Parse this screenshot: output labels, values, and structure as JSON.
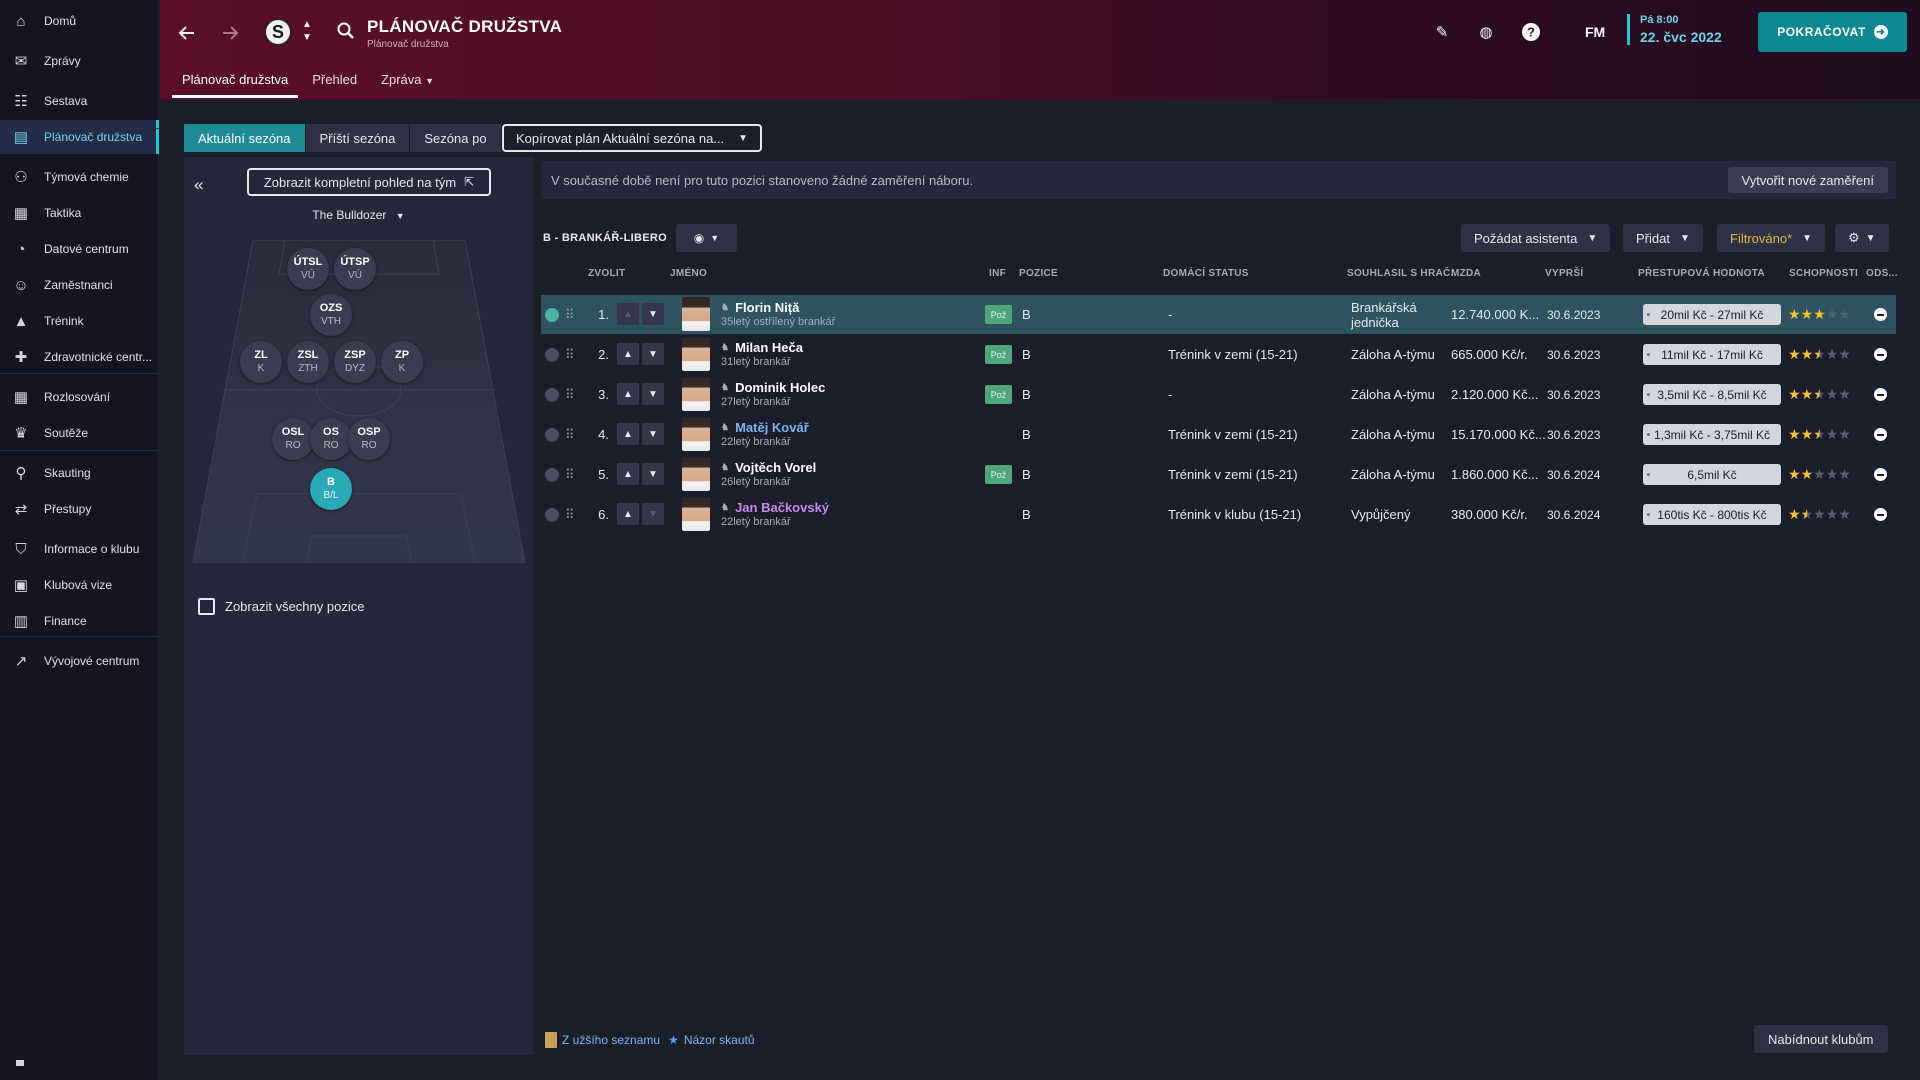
{
  "sidebar": {
    "items": [
      {
        "label": "Domů",
        "icon": "home-icon",
        "glyph": "⌂"
      },
      {
        "label": "Zprávy",
        "icon": "mail-icon",
        "glyph": "✉"
      },
      {
        "label": "Sestava",
        "icon": "squad-icon",
        "glyph": "☷"
      },
      {
        "label": "Plánovač družstva",
        "icon": "planner-icon",
        "glyph": "▤"
      },
      {
        "label": "Týmová chemie",
        "icon": "chemistry-icon",
        "glyph": "⚇"
      },
      {
        "label": "Taktika",
        "icon": "tactics-icon",
        "glyph": "▦"
      },
      {
        "label": "Datové centrum",
        "icon": "data-hub-icon",
        "glyph": "◔"
      },
      {
        "label": "Zaměstnanci",
        "icon": "staff-icon",
        "glyph": "☺"
      },
      {
        "label": "Trénink",
        "icon": "training-icon",
        "glyph": "▲"
      },
      {
        "label": "Zdravotnické centr...",
        "icon": "medical-icon",
        "glyph": "✚"
      },
      {
        "label": "Rozlosování",
        "icon": "calendar-icon",
        "glyph": "▦"
      },
      {
        "label": "Soutěže",
        "icon": "trophy-icon",
        "glyph": "♛"
      },
      {
        "label": "Skauting",
        "icon": "scouting-icon",
        "glyph": "⚲"
      },
      {
        "label": "Přestupy",
        "icon": "transfers-icon",
        "glyph": "⇄"
      },
      {
        "label": "Informace o klubu",
        "icon": "club-info-icon",
        "glyph": "⛉"
      },
      {
        "label": "Klubová vize",
        "icon": "club-vision-icon",
        "glyph": "▣"
      },
      {
        "label": "Finance",
        "icon": "finances-icon",
        "glyph": "▥"
      },
      {
        "label": "Vývojové centrum",
        "icon": "dev-centre-icon",
        "glyph": "↗"
      }
    ]
  },
  "header": {
    "title": "PLÁNOVAČ DRUŽSTVA",
    "subtitle": "Plánovač družstva",
    "club_letter": "S",
    "tabs": [
      "Plánovač družstva",
      "Přehled",
      "Zpráva"
    ],
    "fm_logo": "FM",
    "date_day": "Pá 8:00",
    "date_main": "22. čvc 2022",
    "continue_label": "POKRAČOVAT",
    "accent_color": "#0f8790"
  },
  "season": {
    "options": [
      "Aktuální sezóna",
      "Příští sezóna",
      "Sezóna po"
    ],
    "copy_plan": "Kopírovat plán Aktuální sezóna na..."
  },
  "left": {
    "full_view": "Zobrazit kompletní pohled na tým",
    "formation": "The Bulldozer",
    "positions": [
      {
        "code": "ÚTSL",
        "role": "VÚ"
      },
      {
        "code": "ÚTSP",
        "role": "VÚ"
      },
      {
        "code": "OZS",
        "role": "VTH"
      },
      {
        "code": "ZL",
        "role": "K"
      },
      {
        "code": "ZSL",
        "role": "ZTH"
      },
      {
        "code": "ZSP",
        "role": "DYZ"
      },
      {
        "code": "ZP",
        "role": "K"
      },
      {
        "code": "OSL",
        "role": "RO"
      },
      {
        "code": "OS",
        "role": "RO"
      },
      {
        "code": "OSP",
        "role": "RO"
      },
      {
        "code": "B",
        "role": "B/L"
      }
    ],
    "show_all": "Zobrazit všechny pozice"
  },
  "main": {
    "info_text": "V současné době není pro tuto pozici stanoveno žádné zaměření náboru.",
    "new_focus": "Vytvořit nové zaměření",
    "position_heading": "B - BRANKÁŘ-LIBERO",
    "ask_assistant": "Požádat asistenta",
    "add": "Přidat",
    "filtered": "Filtrováno*",
    "columns": [
      "ZVOLIT",
      "JMÉNO",
      "INF",
      "POZICE",
      "DOMÁCÍ STATUS",
      "SOUHLASIL S HRAČ...",
      "MZDA",
      "VYPRŠÍ",
      "PŘESTUPOVÁ HODNOTA",
      "SCHOPNOSTI",
      "ODS..."
    ],
    "rows": [
      {
        "num": "1.",
        "name": "Florin Niță",
        "desc": "35letý ostřílený brankář",
        "inf": "Pož",
        "pos": "B",
        "home": "-",
        "agreed": "Brankářská jednička",
        "wage": "12.740.000 K...",
        "expires": "30.6.2023",
        "value": "20mil Kč - 27mil Kč",
        "stars": 3,
        "style": "normal",
        "selected": true
      },
      {
        "num": "2.",
        "name": "Milan Heča",
        "desc": "31letý brankář",
        "inf": "Pož",
        "pos": "B",
        "home": "Trénink v zemi (15-21)",
        "agreed": "Záloha A-týmu",
        "wage": "665.000 Kč/r.",
        "expires": "30.6.2023",
        "value": "11mil Kč - 17mil Kč",
        "stars": 2.5,
        "style": "normal",
        "selected": false
      },
      {
        "num": "3.",
        "name": "Dominik Holec",
        "desc": "27letý brankář",
        "inf": "Pož",
        "pos": "B",
        "home": "-",
        "agreed": "Záloha A-týmu",
        "wage": "2.120.000 Kč...",
        "expires": "30.6.2023",
        "value": "3,5mil Kč - 8,5mil Kč",
        "stars": 2.5,
        "style": "normal",
        "selected": false
      },
      {
        "num": "4.",
        "name": "Matěj Kovář",
        "desc": "22letý brankář",
        "inf": "",
        "pos": "B",
        "home": "Trénink v zemi (15-21)",
        "agreed": "Záloha A-týmu",
        "wage": "15.170.000 Kč...",
        "expires": "30.6.2023",
        "value": "1,3mil Kč - 3,75mil Kč",
        "stars": 2.5,
        "style": "blue",
        "selected": false
      },
      {
        "num": "5.",
        "name": "Vojtěch Vorel",
        "desc": "26letý brankář",
        "inf": "Pož",
        "pos": "B",
        "home": "Trénink v zemi (15-21)",
        "agreed": "Záloha A-týmu",
        "wage": "1.860.000 Kč...",
        "expires": "30.6.2024",
        "value": "6,5mil Kč",
        "stars": 2,
        "style": "normal",
        "selected": false
      },
      {
        "num": "6.",
        "name": "Jan Bačkovský",
        "desc": "22letý brankář",
        "inf": "",
        "pos": "B",
        "home": "Trénink v klubu (15-21)",
        "agreed": "Vypůjčený",
        "wage": "380.000 Kč/r.",
        "expires": "30.6.2024",
        "value": "160tis Kč - 800tis Kč",
        "stars": 1.5,
        "style": "purple",
        "selected": false
      }
    ],
    "shortlist": "Z užšího seznamu",
    "scout_view": "Názor skautů",
    "offer_clubs": "Nabídnout klubům"
  }
}
